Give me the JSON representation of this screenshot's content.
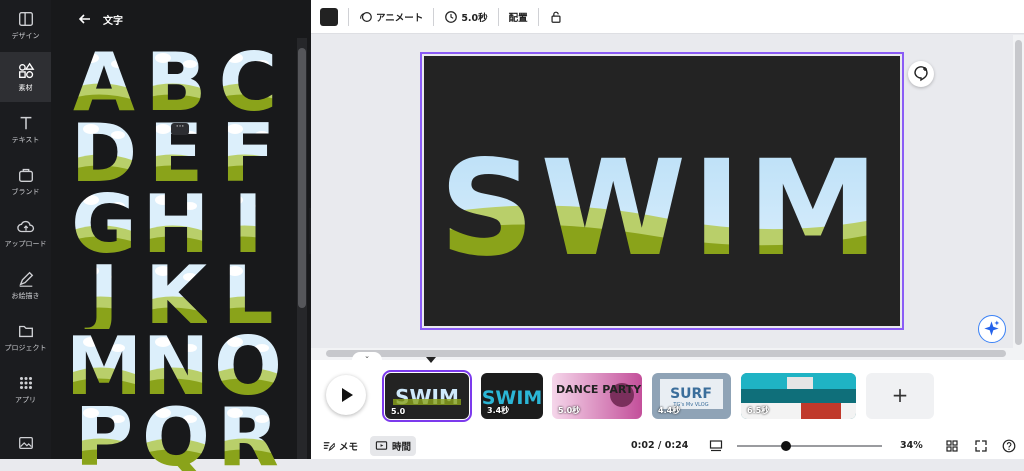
{
  "rail": {
    "items": [
      {
        "label": "デザイン",
        "icon": "layout-icon"
      },
      {
        "label": "素材",
        "icon": "elements-icon"
      },
      {
        "label": "テキスト",
        "icon": "text-icon"
      },
      {
        "label": "ブランド",
        "icon": "brand-icon"
      },
      {
        "label": "アップロード",
        "icon": "upload-icon"
      },
      {
        "label": "お絵描き",
        "icon": "draw-icon"
      },
      {
        "label": "プロジェクト",
        "icon": "folder-icon"
      },
      {
        "label": "アプリ",
        "icon": "apps-icon"
      }
    ]
  },
  "panel": {
    "title": "文字",
    "letters": [
      "A",
      "B",
      "C",
      "D",
      "E",
      "F",
      "G",
      "H",
      "I",
      "J",
      "K",
      "L",
      "M",
      "N",
      "O",
      "P",
      "Q",
      "R"
    ]
  },
  "toolbar": {
    "animate": "アニメート",
    "duration": "5.0秒",
    "position": "配置"
  },
  "canvas": {
    "word": "SWIM",
    "colors": {
      "background": "#232323",
      "sky": "#cfe9fb",
      "grass": "#8aa31a",
      "selection": "#8b5cf6"
    }
  },
  "timeline": {
    "clips": [
      {
        "text": "SWIM",
        "duration": "5.0",
        "selected": true
      },
      {
        "text": "SWIM",
        "duration": "3.4秒"
      },
      {
        "text": "DANCE PARTY",
        "duration": "5.0秒"
      },
      {
        "text": "SURF",
        "subtitle": "TG's Mv VLOG",
        "duration": "4.4秒"
      },
      {
        "text": "",
        "duration": "6.5秒"
      }
    ],
    "add": "+"
  },
  "bottom": {
    "notes": "メモ",
    "timing": "時間",
    "timecode": "0:02 / 0:24",
    "zoom": "34%",
    "zoom_fraction": 0.34
  }
}
